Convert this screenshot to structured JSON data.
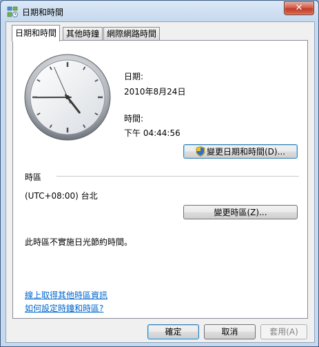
{
  "window": {
    "title": "日期和時間",
    "close_label": "✕"
  },
  "tabs": [
    {
      "label": "日期和時間"
    },
    {
      "label": "其他時鐘"
    },
    {
      "label": "網際網路時間"
    }
  ],
  "clock": {
    "hour": 16,
    "minute": 44,
    "second": 56
  },
  "date": {
    "label": "日期:",
    "value": "2010年8月24日"
  },
  "time": {
    "label": "時間:",
    "value": "下午 04:44:56"
  },
  "change_datetime_button": "變更日期和時間(D)...",
  "timezone": {
    "section_label": "時區",
    "value": "(UTC+08:00) 台北",
    "change_button": "變更時區(Z)...",
    "dst_note": "此時區不實施日光節約時間。"
  },
  "links": {
    "online_tz_info": "線上取得其他時區資訊",
    "how_to_set": "如何設定時鐘和時區?"
  },
  "footer": {
    "ok": "確定",
    "cancel": "取消",
    "apply": "套用(A)"
  }
}
